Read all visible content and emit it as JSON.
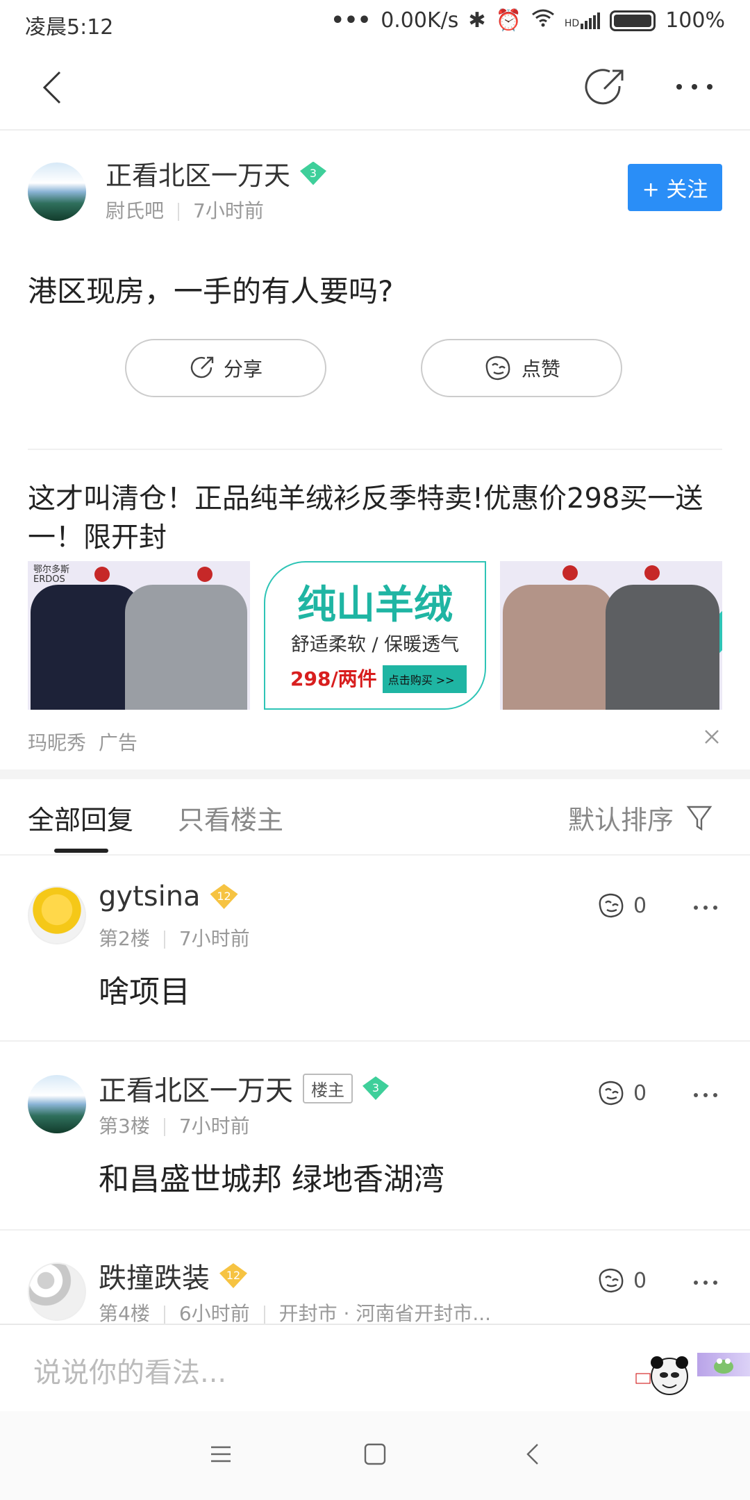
{
  "status_bar": {
    "time": "凌晨5:12",
    "network_speed": "0.00K/s",
    "signal_label": "HD",
    "battery": "100%"
  },
  "post": {
    "author": "正看北区一万天",
    "author_level": "3",
    "forum": "尉氏吧",
    "time": "7小时前",
    "follow_label": "+ 关注",
    "title": "港区现房，一手的有人要吗?",
    "share_label": "分享",
    "like_label": "点赞"
  },
  "ad": {
    "title": "这才叫清仓！正品纯羊绒衫反季特卖!优惠价298买一送一！限开封",
    "brand_mark": "鄂尔多斯",
    "brand_sub": "ERDOS",
    "banner_title": "纯山羊绒",
    "banner_sub": "舒适柔软 / 保暖透气",
    "banner_price": "298/两件",
    "banner_cta": "点击购买 >>",
    "source": "玛昵秀",
    "tag": "广告"
  },
  "tabs": {
    "all": "全部回复",
    "op_only": "只看楼主",
    "sort": "默认排序"
  },
  "replies": [
    {
      "user": "gytsina",
      "level": "12",
      "floor": "第2楼",
      "time": "7小时前",
      "location": "",
      "body": "啥项目",
      "likes": "0",
      "op_tag": ""
    },
    {
      "user": "正看北区一万天",
      "level": "3",
      "floor": "第3楼",
      "time": "7小时前",
      "location": "",
      "body": "和昌盛世城邦 绿地香湖湾",
      "likes": "0",
      "op_tag": "楼主"
    },
    {
      "user": "跌撞跌装",
      "level": "12",
      "floor": "第4楼",
      "time": "6小时前",
      "location": "开封市 · 河南省开封市...",
      "body": "",
      "likes": "0",
      "op_tag": ""
    }
  ],
  "comment_input": {
    "placeholder": "说说你的看法..."
  },
  "colors": {
    "accent": "#2a8ef7",
    "level_green": "#3ecf9a",
    "level_gold": "#f6c342"
  }
}
